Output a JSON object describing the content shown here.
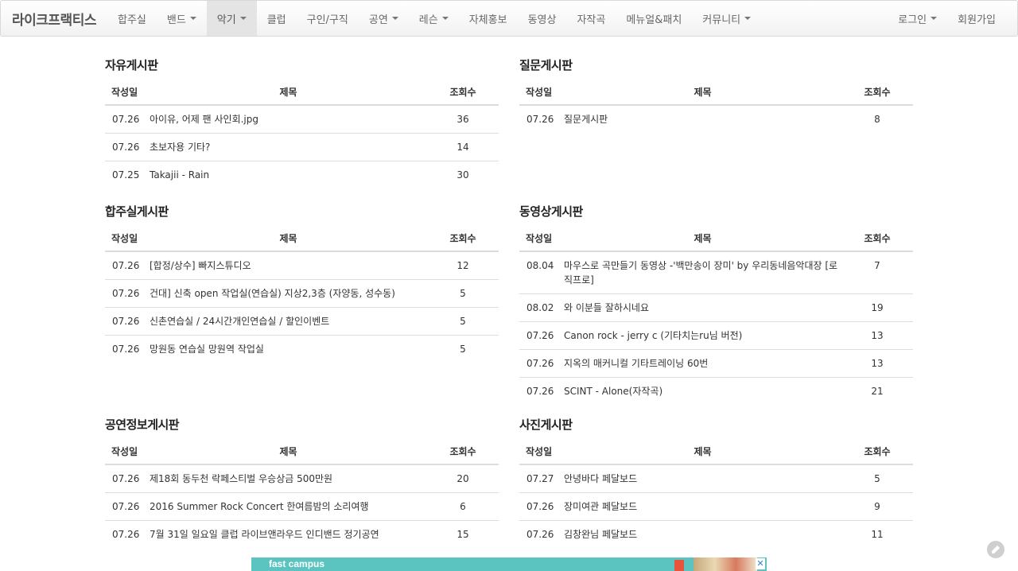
{
  "nav": {
    "brand": "라이크프랙티스",
    "items": [
      {
        "label": "합주실",
        "dropdown": false,
        "active": false
      },
      {
        "label": "밴드",
        "dropdown": true,
        "active": false
      },
      {
        "label": "악기",
        "dropdown": true,
        "active": true
      },
      {
        "label": "클럽",
        "dropdown": false,
        "active": false
      },
      {
        "label": "구인/구직",
        "dropdown": false,
        "active": false
      },
      {
        "label": "공연",
        "dropdown": true,
        "active": false
      },
      {
        "label": "레슨",
        "dropdown": true,
        "active": false
      },
      {
        "label": "자체홍보",
        "dropdown": false,
        "active": false
      },
      {
        "label": "동영상",
        "dropdown": false,
        "active": false
      },
      {
        "label": "자작곡",
        "dropdown": false,
        "active": false
      },
      {
        "label": "메뉴얼&패치",
        "dropdown": false,
        "active": false
      },
      {
        "label": "커뮤니티",
        "dropdown": true,
        "active": false
      }
    ],
    "login": "로그인",
    "signup": "회원가입"
  },
  "columns": {
    "date": "작성일",
    "title": "제목",
    "views": "조회수"
  },
  "boards": {
    "free": {
      "title": "자유게시판",
      "rows": [
        {
          "date": "07.26",
          "title": "아이유, 어제 팬 사인회.jpg",
          "views": "36"
        },
        {
          "date": "07.26",
          "title": "초보자용 기타?",
          "views": "14"
        },
        {
          "date": "07.25",
          "title": "Takajii - Rain",
          "views": "30"
        }
      ]
    },
    "qna": {
      "title": "질문게시판",
      "rows": [
        {
          "date": "07.26",
          "title": "질문게시판",
          "views": "8"
        }
      ]
    },
    "studio": {
      "title": "합주실게시판",
      "rows": [
        {
          "date": "07.26",
          "title": "[합정/상수] 빠지스튜디오",
          "views": "12"
        },
        {
          "date": "07.26",
          "title": "건대] 신축 open 작업실(연습실) 지상2,3층 (자양동, 성수동)",
          "views": "5"
        },
        {
          "date": "07.26",
          "title": "신촌연습실 / 24시간개인연습실 / 할인이벤트",
          "views": "5"
        },
        {
          "date": "07.26",
          "title": "망원동 연습실 망원역 작업실",
          "views": "5"
        }
      ]
    },
    "video": {
      "title": "동영상게시판",
      "rows": [
        {
          "date": "08.04",
          "title": "마우스로 곡만들기 동영상 -'백만송이 장미' by 우리동네음악대장 [로직프로]",
          "views": "7"
        },
        {
          "date": "08.02",
          "title": "와 이분들 잘하시네요",
          "views": "19"
        },
        {
          "date": "07.26",
          "title": "Canon rock - jerry c (기타치는ru님 버전)",
          "views": "13"
        },
        {
          "date": "07.26",
          "title": "지옥의 매커니컬 기타트레이닝 60번",
          "views": "13"
        },
        {
          "date": "07.26",
          "title": "SCINT - Alone(자작곡)",
          "views": "21"
        }
      ]
    },
    "concert": {
      "title": "공연정보게시판",
      "rows": [
        {
          "date": "07.26",
          "title": "제18회 동두천 락페스티벌 우승상금 500만원",
          "views": "20"
        },
        {
          "date": "07.26",
          "title": "2016 Summer Rock Concert 한여름밤의 소리여행",
          "views": "6"
        },
        {
          "date": "07.26",
          "title": "7월 31일 일요일 클럽 라이브앤라우드 인디밴드 정기공연",
          "views": "15"
        }
      ]
    },
    "photo": {
      "title": "사진게시판",
      "rows": [
        {
          "date": "07.27",
          "title": "안녕바다 페달보드",
          "views": "5"
        },
        {
          "date": "07.26",
          "title": "장미여관 페달보드",
          "views": "9"
        },
        {
          "date": "07.26",
          "title": "김창완님 페달보드",
          "views": "11"
        }
      ]
    }
  },
  "ad": {
    "text": "fast campus",
    "close": "✕"
  }
}
